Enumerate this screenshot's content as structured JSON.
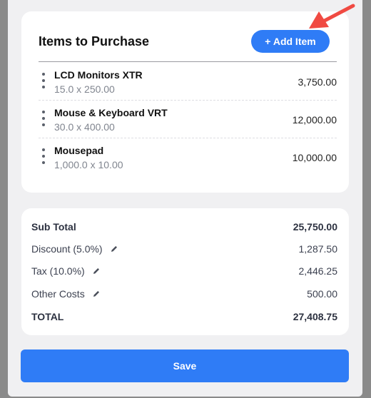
{
  "items_card": {
    "title": "Items to Purchase",
    "add_button_label": "+ Add Item",
    "items": [
      {
        "name": "LCD Monitors XTR",
        "detail": "15.0 x 250.00",
        "amount": "3,750.00"
      },
      {
        "name": "Mouse & Keyboard VRT",
        "detail": "30.0 x 400.00",
        "amount": "12,000.00"
      },
      {
        "name": "Mousepad",
        "detail": "1,000.0 x 10.00",
        "amount": "10,000.00"
      }
    ]
  },
  "totals": {
    "subtotal": {
      "label": "Sub Total",
      "value": "25,750.00"
    },
    "discount": {
      "label": "Discount (5.0%)",
      "value": "1,287.50"
    },
    "tax": {
      "label": "Tax (10.0%)",
      "value": "2,446.25"
    },
    "other_costs": {
      "label": "Other Costs",
      "value": "500.00"
    },
    "total": {
      "label": "TOTAL",
      "value": "27,408.75"
    }
  },
  "save_label": "Save",
  "colors": {
    "accent": "#2f7cf6",
    "annotation_arrow": "#f04a42"
  }
}
